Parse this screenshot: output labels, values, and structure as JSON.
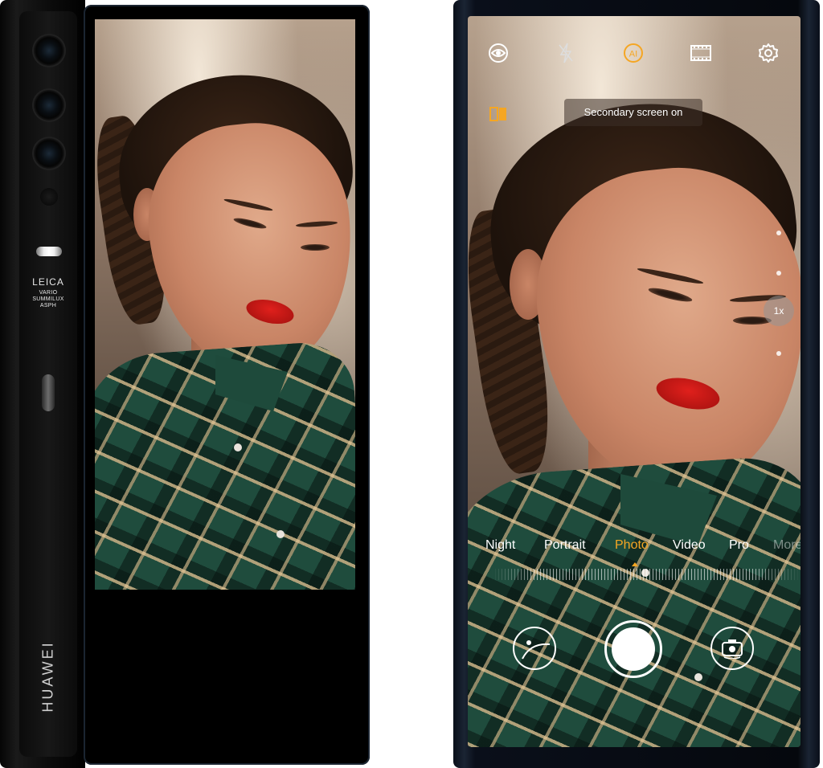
{
  "device": {
    "brand": "HUAWEI",
    "camera_brand": "LEICA",
    "lens_text": [
      "VARIO",
      "SUMMILUX",
      "ASPH"
    ]
  },
  "camera_ui": {
    "top_icons": [
      "aperture-icon",
      "flash-off-icon",
      "ai-icon",
      "film-icon",
      "gear-icon"
    ],
    "ai_label": "AI",
    "toast": "Secondary screen on",
    "zoom_label": "1x",
    "modes": [
      {
        "label": "Night",
        "state": "normal"
      },
      {
        "label": "Portrait",
        "state": "normal"
      },
      {
        "label": "Photo",
        "state": "active"
      },
      {
        "label": "Video",
        "state": "normal"
      },
      {
        "label": "Pro",
        "state": "normal"
      },
      {
        "label": "More",
        "state": "faded"
      }
    ],
    "accent_color": "#f5a623"
  }
}
